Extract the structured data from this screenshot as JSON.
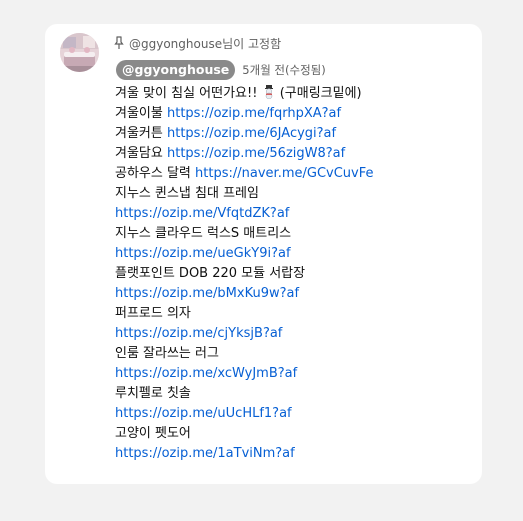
{
  "pinned": {
    "label_prefix": "@ggyonghouse",
    "label_suffix": "님이 고정함",
    "icon": "pin-icon"
  },
  "comment": {
    "author": "@ggyonghouse",
    "timestamp": "5개월 전(수정됨)",
    "intro": "겨울 맞이 침실 어떤가요!!",
    "intro_icon": "snowman-emoji",
    "intro_suffix": "(구매링크밑에)",
    "lines": [
      {
        "label": "겨울이불",
        "link": "https://ozip.me/fqrhpXA?af"
      },
      {
        "label": "겨울커튼",
        "link": "https://ozip.me/6JAcygi?af"
      },
      {
        "label": "겨울담요",
        "link": "https://ozip.me/56zigW8?af"
      },
      {
        "label": "공하우스 달력",
        "link": "https://naver.me/GCvCuvFe"
      },
      {
        "label": "지누스 퀸스냅 침대 프레임",
        "link": ""
      },
      {
        "label": "",
        "link": "https://ozip.me/VfqtdZK?af"
      },
      {
        "label": "지누스 클라우드 럭스S 매트리스",
        "link": ""
      },
      {
        "label": "",
        "link": "https://ozip.me/ueGkY9i?af"
      },
      {
        "label": "플랫포인트 DOB 220 모듈 서랍장",
        "link": ""
      },
      {
        "label": "",
        "link": "https://ozip.me/bMxKu9w?af"
      },
      {
        "label": "퍼프로드 의자",
        "link": ""
      },
      {
        "label": "",
        "link": "https://ozip.me/cjYksjB?af"
      },
      {
        "label": "인룸 잘라쓰는 러그",
        "link": ""
      },
      {
        "label": "",
        "link": "https://ozip.me/xcWyJmB?af"
      },
      {
        "label": "루치펠로 칫솔",
        "link": ""
      },
      {
        "label": "",
        "link": "https://ozip.me/uUcHLf1?af"
      },
      {
        "label": "고양이 펫도어",
        "link": ""
      },
      {
        "label": "",
        "link": "https://ozip.me/1aTviNm?af"
      }
    ]
  },
  "colors": {
    "page_bg": "#f2f2f2",
    "card_bg": "#ffffff",
    "link": "#065fd4",
    "author_chip": "#8a8a8a",
    "meta_text": "#606060",
    "body_text": "#0f0f0f"
  }
}
